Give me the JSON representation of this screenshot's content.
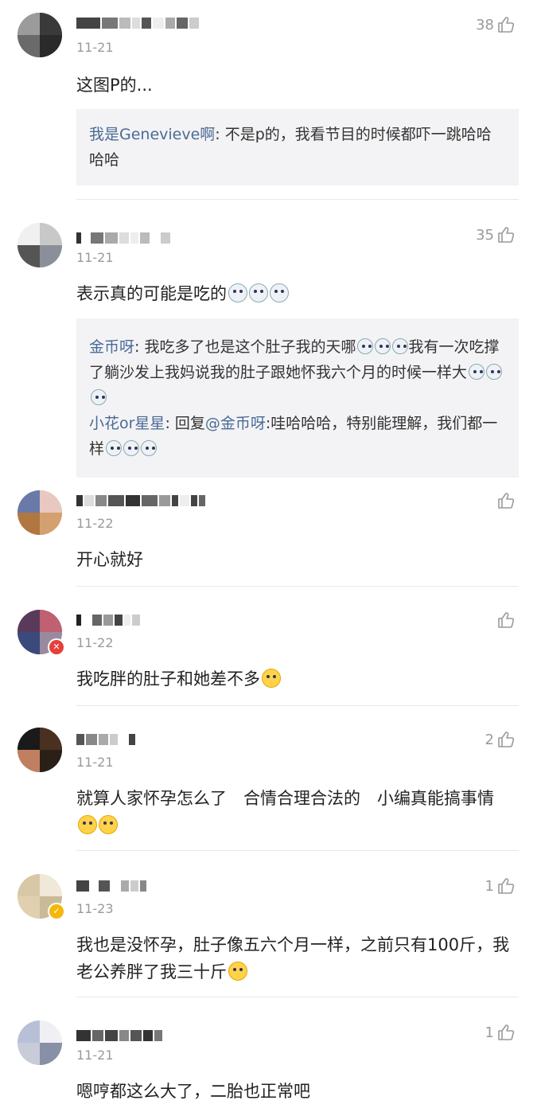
{
  "comments": [
    {
      "date": "11-21",
      "likes": "38",
      "text": "这图P的...",
      "replies": [
        {
          "author": "我是Genevieve啊",
          "sep": ": ",
          "body": "不是p的，我看节目的时候都吓一跳哈哈哈哈"
        }
      ]
    },
    {
      "date": "11-21",
      "likes": "35",
      "text": "表示真的可能是吃的",
      "replies": [
        {
          "author": "金币呀",
          "sep": ": ",
          "body1": "我吃多了也是这个肚子我的天哪",
          "body2": "我有一次吃撑了躺沙发上我妈说我的肚子跟她怀我六个月的时候一样大"
        },
        {
          "author": "小花or星星",
          "sep": ": 回复",
          "mention": "@金币呀",
          "body": ":哇哈哈哈，特别能理解，我们都一样"
        }
      ]
    },
    {
      "date": "11-22",
      "likes": "",
      "text": "开心就好"
    },
    {
      "date": "11-22",
      "likes": "",
      "text": "我吃胖的肚子和她差不多"
    },
    {
      "date": "11-21",
      "likes": "2",
      "text": "就算人家怀孕怎么了　合情合理合法的　小编真能搞事情"
    },
    {
      "date": "11-23",
      "likes": "1",
      "text": "我也是没怀孕，肚子像五六个月一样，之前只有100斤，我老公养胖了我三十斤"
    },
    {
      "date": "11-21",
      "likes": "1",
      "text": "嗯哼都这么大了，二胎也正常吧"
    }
  ],
  "icons": {
    "like": "thumbs-up-icon",
    "emoji": "emoji-icon"
  },
  "colors": {
    "reply_name": "#4a6a96",
    "meta": "#9a9a9a",
    "reply_bg": "#f3f3f5"
  }
}
